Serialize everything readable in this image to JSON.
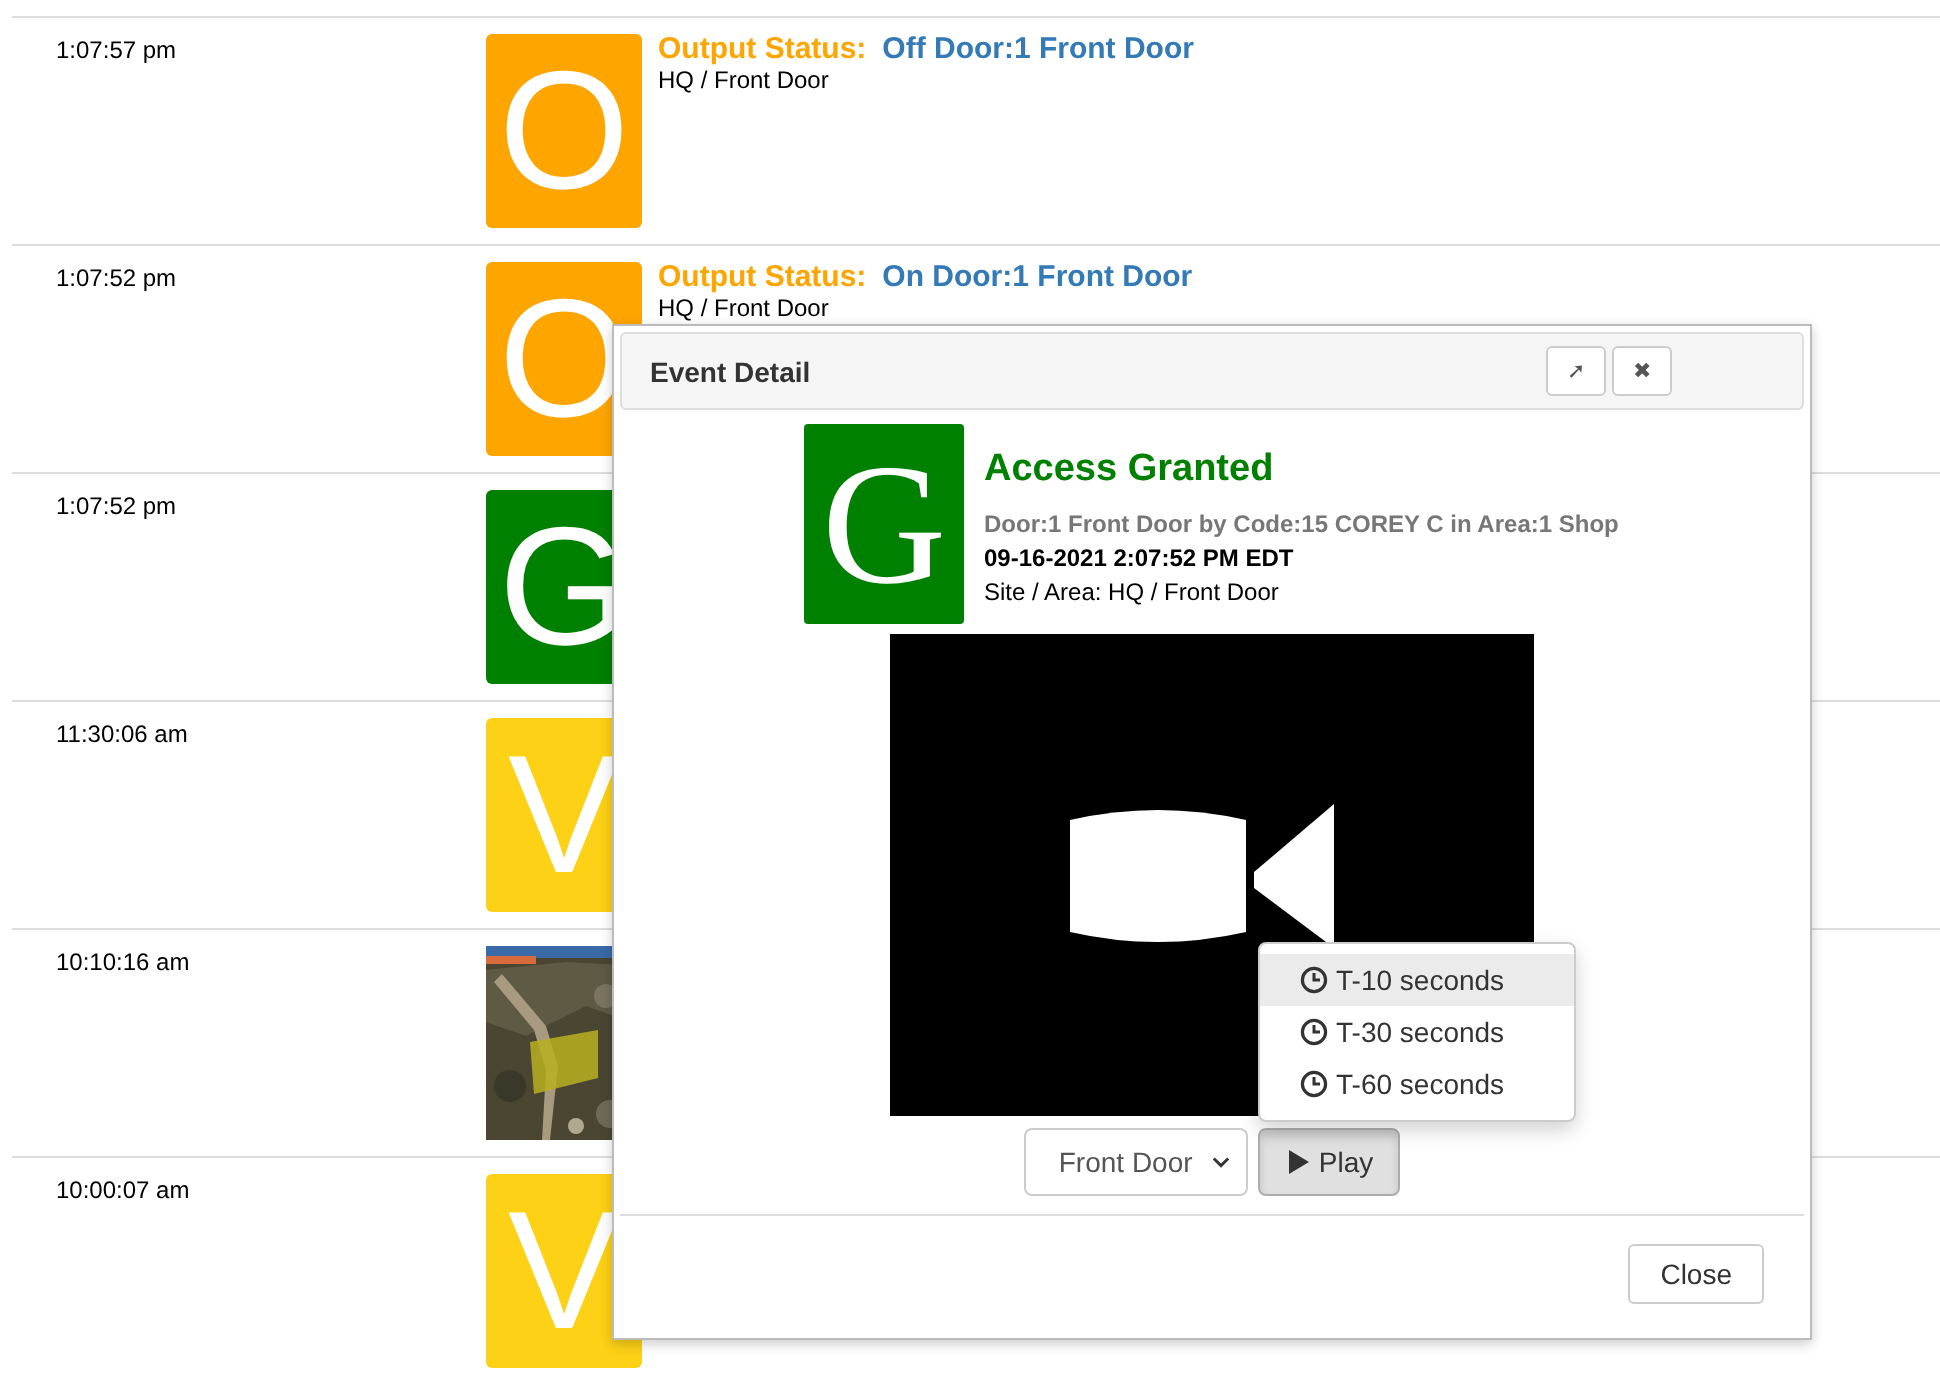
{
  "events": [
    {
      "time": "1:07:57 pm",
      "tile": {
        "kind": "letter",
        "letter": "O",
        "color": "#ffa500"
      },
      "label": "Output Status:",
      "value": "Off Door:1 Front Door",
      "site": "HQ / Front Door"
    },
    {
      "time": "1:07:52 pm",
      "tile": {
        "kind": "letter",
        "letter": "O",
        "color": "#ffa500"
      },
      "label": "Output Status:",
      "value": "On Door:1 Front Door",
      "site": "HQ / Front Door"
    },
    {
      "time": "1:07:52 pm",
      "tile": {
        "kind": "letter",
        "letter": "G",
        "color": "#008000"
      }
    },
    {
      "time": "11:30:06 am",
      "tile": {
        "kind": "letter",
        "letter": "V",
        "color": "#fcd116"
      }
    },
    {
      "time": "10:10:16 am"
    },
    {
      "time": "10:00:07 am",
      "tile": {
        "kind": "letter",
        "letter": "V",
        "color": "#fcd116"
      }
    }
  ],
  "modal": {
    "title": "Event Detail",
    "header_buttons": [
      "➚",
      "✖"
    ],
    "tile": {
      "letter": "G",
      "color": "#008000"
    },
    "heading": "Access Granted",
    "detail": "Door:1 Front Door by Code:15 COREY C in Area:1 Shop",
    "datetime": "09-16-2021 2:07:52 PM EDT",
    "site": "Site / Area: HQ / Front Door",
    "menu": [
      {
        "label": "T-10 seconds",
        "selected": true
      },
      {
        "label": "T-30 seconds",
        "selected": false
      },
      {
        "label": "T-60 seconds",
        "selected": false
      }
    ],
    "camera_select": "Front Door",
    "play": {
      "label": "Play",
      "pressed": true
    },
    "close": "Close"
  }
}
